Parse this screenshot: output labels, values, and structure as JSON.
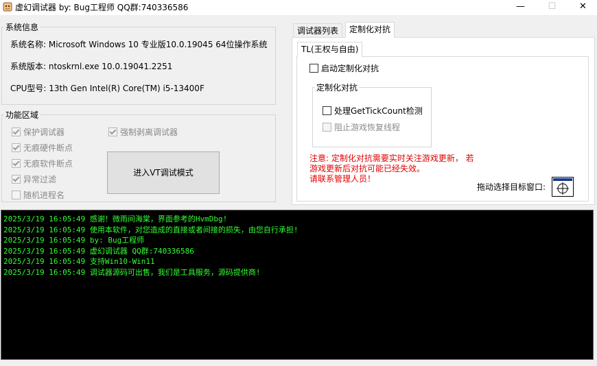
{
  "window": {
    "title": "虚幻调试器    by: Bug工程师    QQ群:740336586",
    "controls": {
      "minimize": "—",
      "maximize": "☐",
      "close": "✕"
    }
  },
  "system_info": {
    "label": "系统信息",
    "os_name": "系统名称:  Microsoft Windows 10 专业版10.0.19045  64位操作系统",
    "os_version": "系统版本:  ntoskrnl.exe  10.0.19041.2251",
    "cpu": "CPU型号:  13th Gen Intel(R) Core(TM) i5-13400F"
  },
  "function_area": {
    "label": "功能区域",
    "checkboxes": [
      {
        "label": "保护调试器",
        "checked": true
      },
      {
        "label": "无痕硬件断点",
        "checked": true
      },
      {
        "label": "无痕软件断点",
        "checked": true
      },
      {
        "label": "异常过滤",
        "checked": true
      },
      {
        "label": "随机进程名",
        "checked": false
      }
    ],
    "force_strip": {
      "label": "强制剥离调试器",
      "checked": true
    },
    "vt_button": "进入VT调试模式"
  },
  "tabs": [
    {
      "label": "调试器列表",
      "active": false
    },
    {
      "label": "定制化对抗",
      "active": true
    }
  ],
  "subtab": {
    "label": "TL(王权与自由)"
  },
  "custom": {
    "enable_label": "启动定制化对抗",
    "group_label": "定制化对抗",
    "option1": "处理GetTickCount检测",
    "option2": "阻止游戏恢复线程",
    "warning_lines": [
      "注意: 定制化对抗需要实时关注游戏更新，  若",
      "游戏更新后对抗可能已经失效。",
      "请联系管理人员！"
    ],
    "drag_label": "拖动选择目标窗口:"
  },
  "log": [
    "2025/3/19 16:05:49 感谢！微雨间海棠，界面参考的HvmDbg!",
    "2025/3/19 16:05:49 使用本软件，对您造成的直接或者间接的损失，由您自行承担!",
    "2025/3/19 16:05:49 by: Bug工程师",
    "2025/3/19 16:05:49 虚幻调试器 QQ群:740336586",
    "2025/3/19 16:05:49 支持Win10-Win11",
    "2025/3/19 16:05:49 调试器源码可出售，我们是工具服务，源码提供商!"
  ]
}
